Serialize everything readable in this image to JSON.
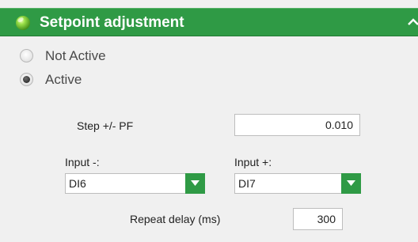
{
  "header": {
    "title": "Setpoint adjustment",
    "icon": "green-ball-icon",
    "collapse_icon": "chevron-up-icon",
    "color": "#2f9a45"
  },
  "mode": {
    "options": [
      {
        "label": "Not Active",
        "checked": false
      },
      {
        "label": "Active",
        "checked": true
      }
    ]
  },
  "step": {
    "label": "Step +/- PF",
    "value": "0.010"
  },
  "input_minus": {
    "label": "Input -:",
    "value": "DI6"
  },
  "input_plus": {
    "label": "Input +:",
    "value": "DI7"
  },
  "repeat_delay": {
    "label": "Repeat delay (ms)",
    "value": "300"
  }
}
